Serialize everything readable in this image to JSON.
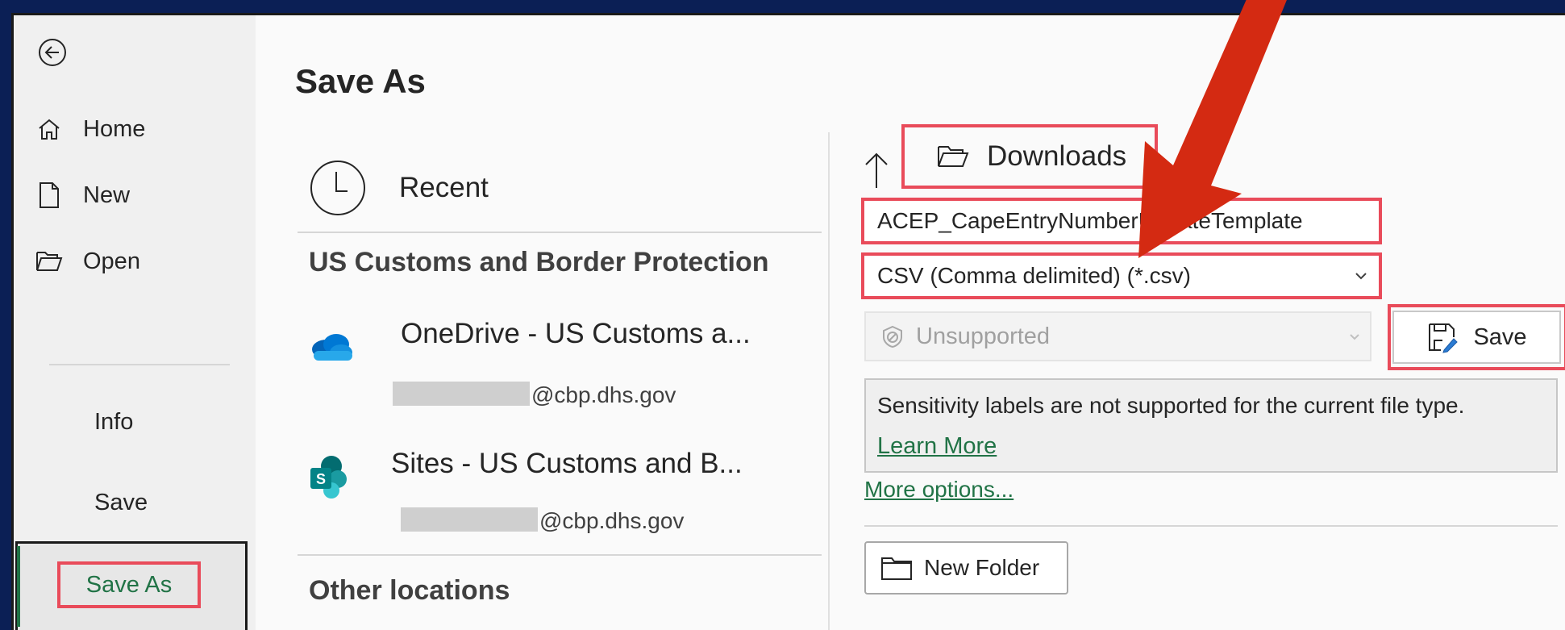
{
  "nav": {
    "items": [
      {
        "label": "Home",
        "icon": "home-icon"
      },
      {
        "label": "New",
        "icon": "new-file-icon"
      },
      {
        "label": "Open",
        "icon": "folder-open-icon"
      }
    ],
    "info_label": "Info",
    "save_label": "Save",
    "saveas_label": "Save As"
  },
  "main": {
    "title": "Save As",
    "recent_label": "Recent",
    "org_heading": "US Customs and Border Protection",
    "locations": [
      {
        "name": "OneDrive - US Customs a...",
        "email": "@cbp.dhs.gov",
        "icon": "onedrive-icon"
      },
      {
        "name": "Sites - US Customs and B...",
        "email": "@cbp.dhs.gov",
        "icon": "sharepoint-icon"
      }
    ],
    "other_heading": "Other locations"
  },
  "right": {
    "folder": "Downloads",
    "filename": "ACEP_CapeEntryNumberUpdateTemplate",
    "filetype": "CSV (Comma delimited) (*.csv)",
    "sensitivity": "Unsupported",
    "save_button": "Save",
    "notice": "Sensitivity labels are not supported for the current file type.",
    "learn_more": "Learn More",
    "more_options": "More options...",
    "new_folder": "New Folder"
  },
  "colors": {
    "accent_green": "#217346",
    "highlight_red": "#e94b5a",
    "arrow_red": "#d42a12",
    "frame_navy": "#0b1f55"
  }
}
